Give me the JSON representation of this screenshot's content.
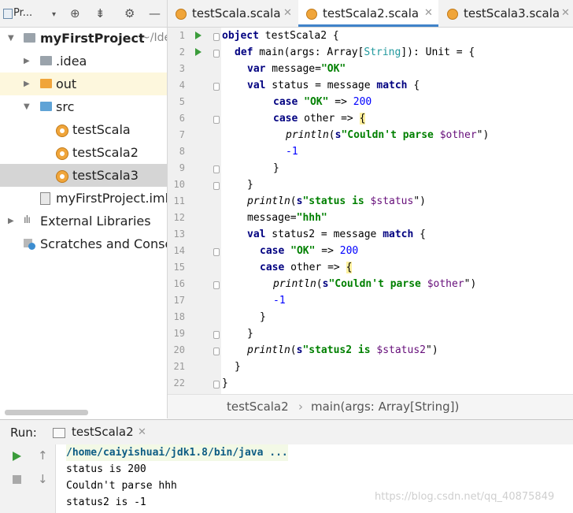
{
  "project_panel": {
    "title": "Pr...",
    "tree": [
      {
        "label": "myFirstProject",
        "suffix": "~/Ide"
      },
      {
        "label": ".idea"
      },
      {
        "label": "out"
      },
      {
        "label": "src"
      },
      {
        "label": "testScala"
      },
      {
        "label": "testScala2"
      },
      {
        "label": "testScala3"
      },
      {
        "label": "myFirstProject.iml"
      },
      {
        "label": "External Libraries"
      },
      {
        "label": "Scratches and Consoles"
      }
    ]
  },
  "editor_tabs": [
    {
      "label": "testScala.scala"
    },
    {
      "label": "testScala2.scala"
    },
    {
      "label": "testScala3.scala"
    }
  ],
  "editor": {
    "line_numbers": [
      "1",
      "2",
      "3",
      "4",
      "5",
      "6",
      "7",
      "8",
      "9",
      "10",
      "11",
      "12",
      "13",
      "14",
      "15",
      "16",
      "17",
      "18",
      "19",
      "20",
      "21",
      "22"
    ],
    "tokens": {
      "object": "object",
      "name": " testScala2 {",
      "def": "def",
      "main": " main(args: Array[",
      "string_type": "String",
      "main_end": "]): Unit = {",
      "var": "var",
      "msg_assign": " message=",
      "ok": "\"OK\"",
      "val": "val",
      "status_eq": " status = message ",
      "match": "match",
      "brace_open": " {",
      "case": "case",
      "arrow": " => ",
      "n200": "200",
      "other": " other => ",
      "lbrace": "{",
      "println": "println",
      "s": "s",
      "couldnt": "\"Couldn't parse ",
      "dollar_other": "$other",
      "q_paren": "\")",
      "neg1": "-1",
      "rbrace": "}",
      "paren_open": "(",
      "status_is": "\"status is ",
      "dollar_status": "$status",
      "hhh": "\"hhh\"",
      "status2_eq": " status2 = message ",
      "status2_is": "\"status2 is ",
      "dollar_status2": "$status2"
    }
  },
  "breadcrumb": {
    "file": "testScala2",
    "sep": "›",
    "method": "main(args: Array[String])"
  },
  "run_panel": {
    "label": "Run:",
    "tab": "testScala2",
    "console": [
      "/home/caiyishuai/jdk1.8/bin/java ...",
      "status is 200",
      "Couldn't parse hhh",
      "status2 is -1"
    ]
  },
  "watermark": "https://blog.csdn.net/qq_40875849",
  "colors": {
    "keyword": "#000080",
    "string": "#008000",
    "number": "#0000ff",
    "accent": "#4083c9"
  }
}
